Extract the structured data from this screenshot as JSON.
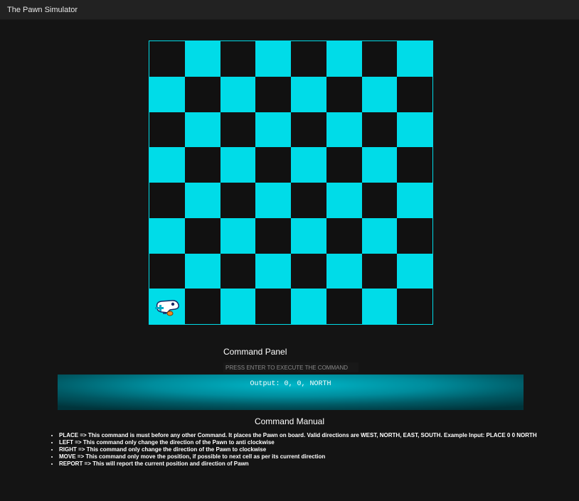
{
  "window": {
    "title": "The Pawn Simulator"
  },
  "board": {
    "size": 8,
    "light_color": "#00dce8",
    "dark_color": "#111111",
    "pawn": {
      "x": 0,
      "y": 0,
      "direction": "NORTH",
      "icon": "pawn-icon"
    }
  },
  "command_panel": {
    "title": "Command Panel",
    "input_value": "",
    "input_placeholder": "PRESS ENTER TO EXECUTE THE COMMAND",
    "output": "Output: 0, 0, NORTH",
    "output_color": "#00b7c9"
  },
  "manual": {
    "title": "Command Manual",
    "items": [
      "PLACE => This command is must before any other Command. It places the Pawn on board. Valid directions are WEST, NORTH, EAST, SOUTH. Example Input: PLACE 0 0 NORTH",
      "LEFT => This command only change the direction of the Pawn to anti clockwise",
      "RIGHT => This command only change the direction of the Pawn to clockwise",
      "MOVE => This command only move the position, if possible to next cell as per its current direction",
      "REPORT => This will report the current position and direction of Pawn"
    ]
  }
}
